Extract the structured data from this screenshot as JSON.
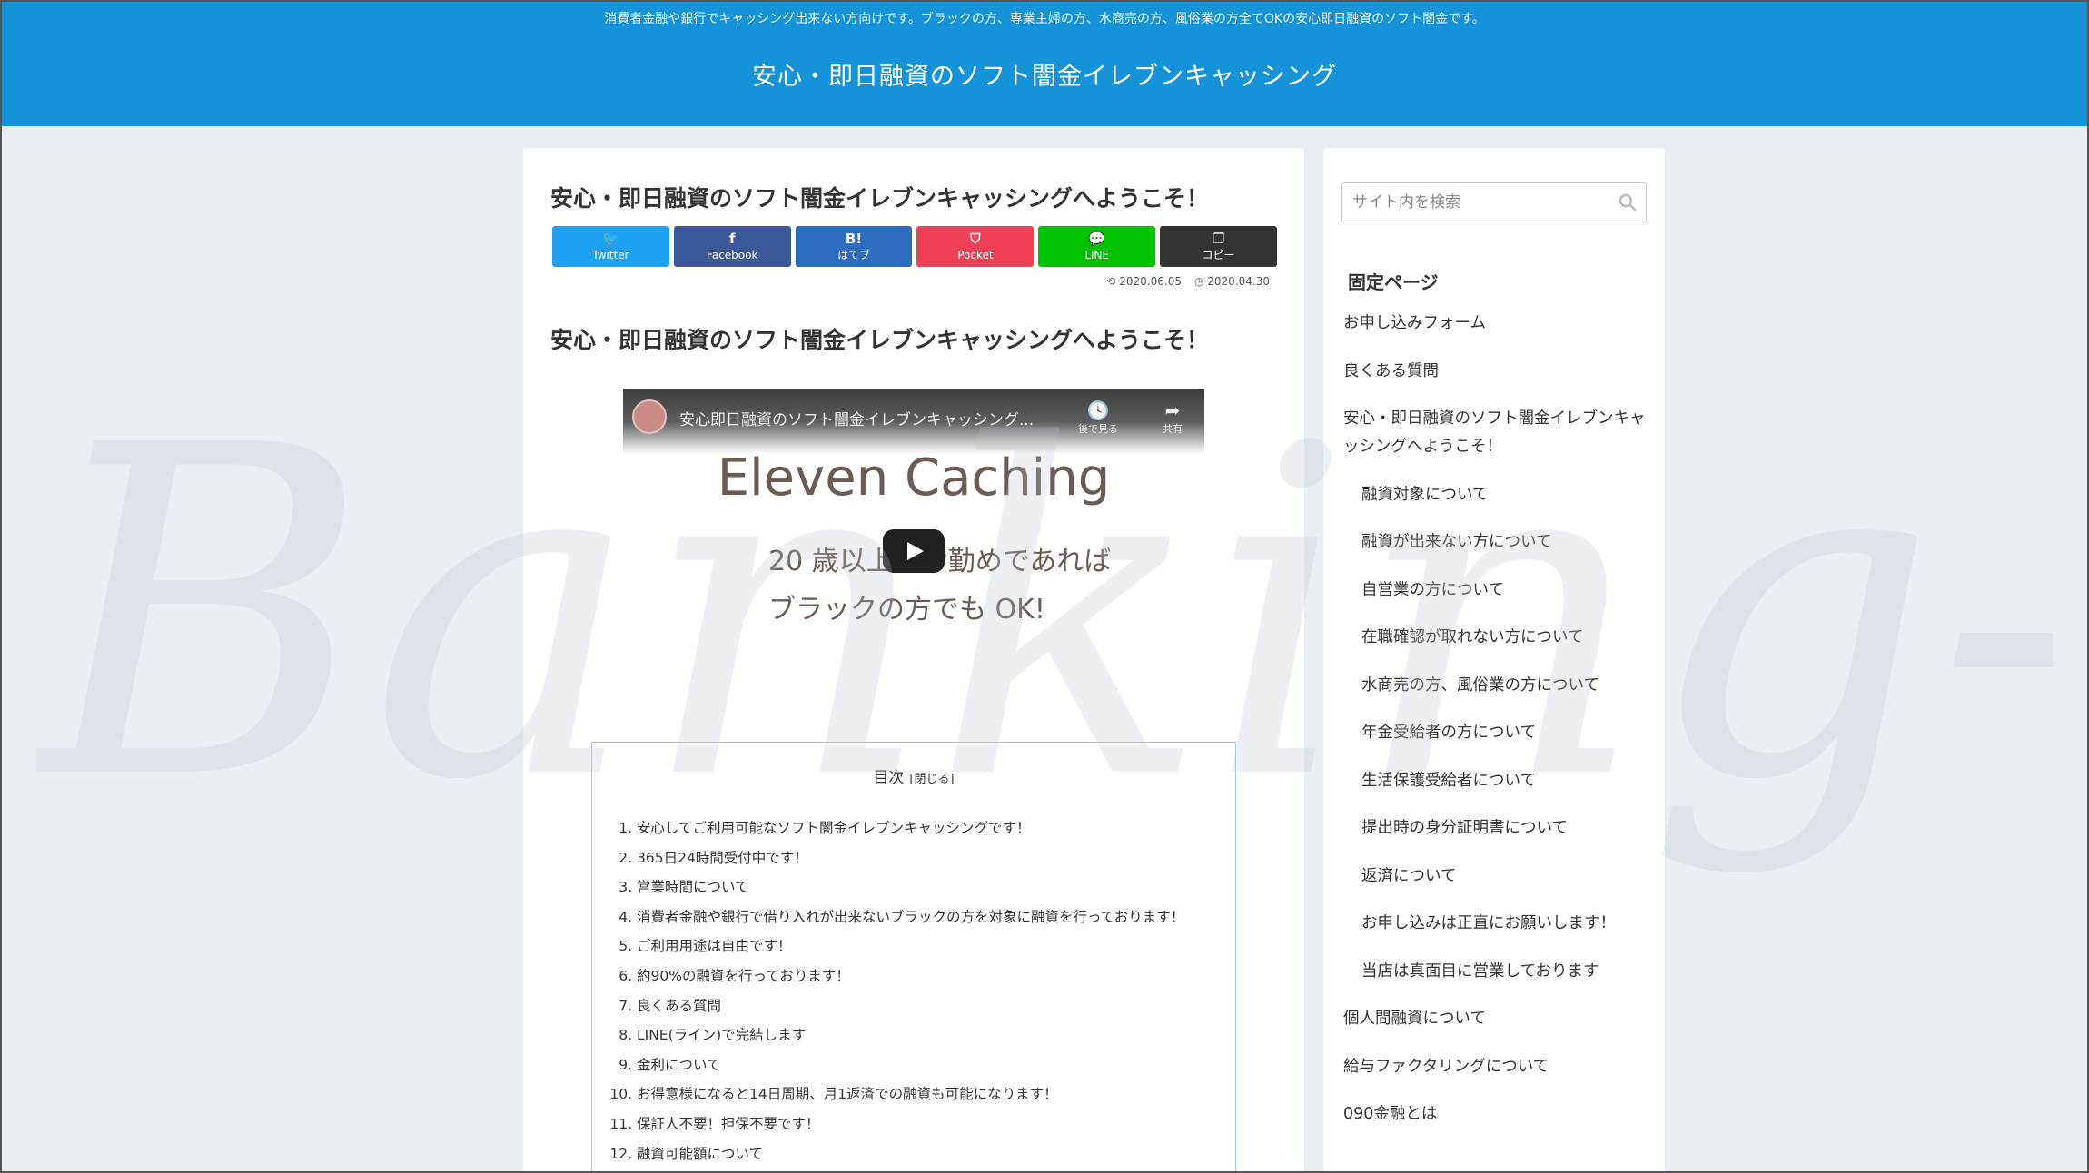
{
  "header": {
    "tagline": "消費者金融や銀行でキャッシング出来ない方向けです。ブラックの方、専業主婦の方、水商売の方、風俗業の方全てOKの安心即日融資のソフト闇金です。",
    "site_title": "安心・即日融資のソフト闇金イレブンキャッシング"
  },
  "article": {
    "title": "安心・即日融資のソフト闇金イレブンキャッシングへようこそ！",
    "share": [
      {
        "icon": "twitter-icon",
        "glyph": "🐦",
        "label": "Twitter",
        "color": "#1da1f2"
      },
      {
        "icon": "facebook-icon",
        "glyph": "f",
        "label": "Facebook",
        "color": "#3b5998"
      },
      {
        "icon": "hatena-icon",
        "glyph": "B!",
        "label": "はてブ",
        "color": "#2c6ebd"
      },
      {
        "icon": "pocket-icon",
        "glyph": "⛉",
        "label": "Pocket",
        "color": "#ef4056"
      },
      {
        "icon": "line-icon",
        "glyph": "💬",
        "label": "LINE",
        "color": "#00c300"
      },
      {
        "icon": "copy-icon",
        "glyph": "❐",
        "label": "コピー",
        "color": "#333333"
      }
    ],
    "updated_date": "2020.06.05",
    "published_date": "2020.04.30",
    "heading": "安心・即日融資のソフト闇金イレブンキャッシングへようこそ！",
    "video": {
      "title": "安心即日融資のソフト闇金イレブンキャッシング...",
      "watch_later": "後で見る",
      "share": "共有",
      "main_text": "Eleven Caching",
      "sub_line1": "20 歳以上でお勤めであれば",
      "sub_line2": "ブラックの方でも OK!"
    },
    "toc": {
      "title": "目次",
      "toggle": "[閉じる]",
      "items": [
        "安心してご利用可能なソフト闇金イレブンキャッシングです！",
        "365日24時間受付中です！",
        "営業時間について",
        "消費者金融や銀行で借り入れが出来ないブラックの方を対象に融資を行っております！",
        "ご利用用途は自由です！",
        "約90%の融資を行っております！",
        "良くある質問",
        "LINE(ライン)で完結します",
        "金利について",
        "お得意様になると14日周期、月1返済での融資も可能になります！",
        "保証人不要！担保不要です！",
        "融資可能額について"
      ]
    }
  },
  "sidebar": {
    "search_placeholder": "サイト内を検索",
    "widget_title": "固定ページ",
    "items": [
      {
        "label": "お申し込みフォーム",
        "sub": false
      },
      {
        "label": "良くある質問",
        "sub": false
      },
      {
        "label": "安心・即日融資のソフト闇金イレブンキャッシングへようこそ！",
        "sub": false
      },
      {
        "label": "融資対象について",
        "sub": true
      },
      {
        "label": "融資が出来ない方について",
        "sub": true
      },
      {
        "label": "自営業の方について",
        "sub": true
      },
      {
        "label": "在職確認が取れない方について",
        "sub": true
      },
      {
        "label": "水商売の方、風俗業の方について",
        "sub": true
      },
      {
        "label": "年金受給者の方について",
        "sub": true
      },
      {
        "label": "生活保護受給者について",
        "sub": true
      },
      {
        "label": "提出時の身分証明書について",
        "sub": true
      },
      {
        "label": "返済について",
        "sub": true
      },
      {
        "label": "お申し込みは正直にお願いします！",
        "sub": true
      },
      {
        "label": "当店は真面目に営業しております",
        "sub": true
      },
      {
        "label": "個人間融資について",
        "sub": false
      },
      {
        "label": "給与ファクタリングについて",
        "sub": false
      },
      {
        "label": "090金融とは",
        "sub": false
      }
    ]
  },
  "watermark": "Banking-S.com"
}
